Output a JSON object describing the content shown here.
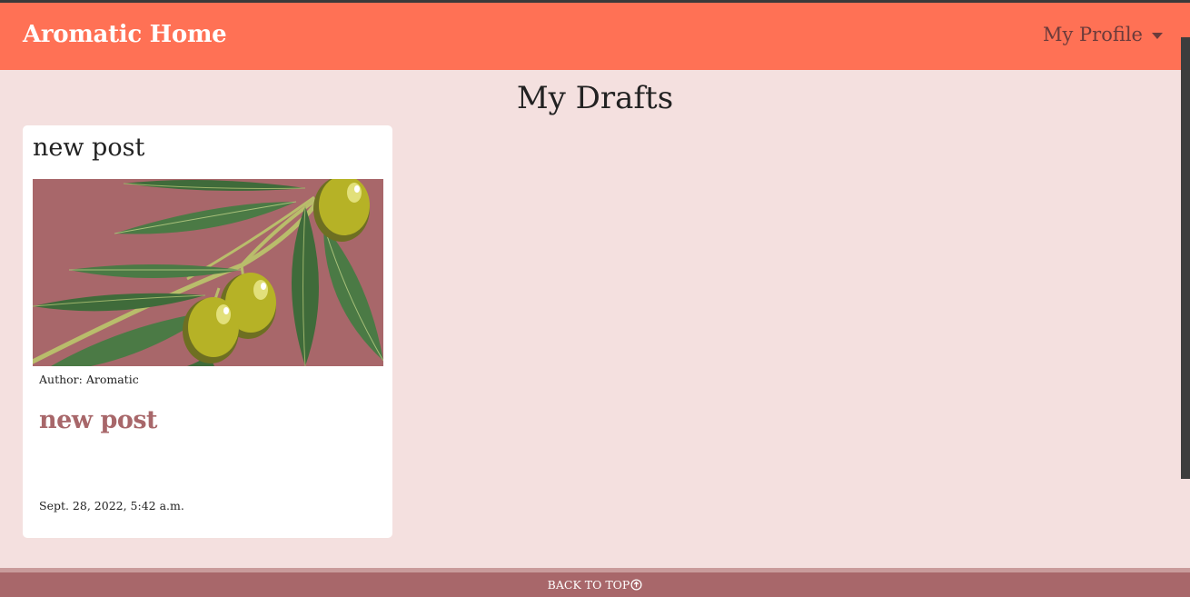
{
  "navbar": {
    "brand": "Aromatic Home",
    "profile_label": "My Profile"
  },
  "main": {
    "title": "My Drafts"
  },
  "drafts": [
    {
      "title": "new post",
      "author": "Author: Aromatic",
      "link_text": "new post",
      "date": "Sept. 28, 2022, 5:42 a.m.",
      "image_icon": "olive-branch-illustration"
    }
  ],
  "footer": {
    "back_to_top": "BACK TO TOP",
    "icon": "arrow-up-circle-icon"
  },
  "colors": {
    "navbar": "#ff7155",
    "background": "#f4e0df",
    "accent": "#a8676a",
    "card": "#ffffff"
  }
}
